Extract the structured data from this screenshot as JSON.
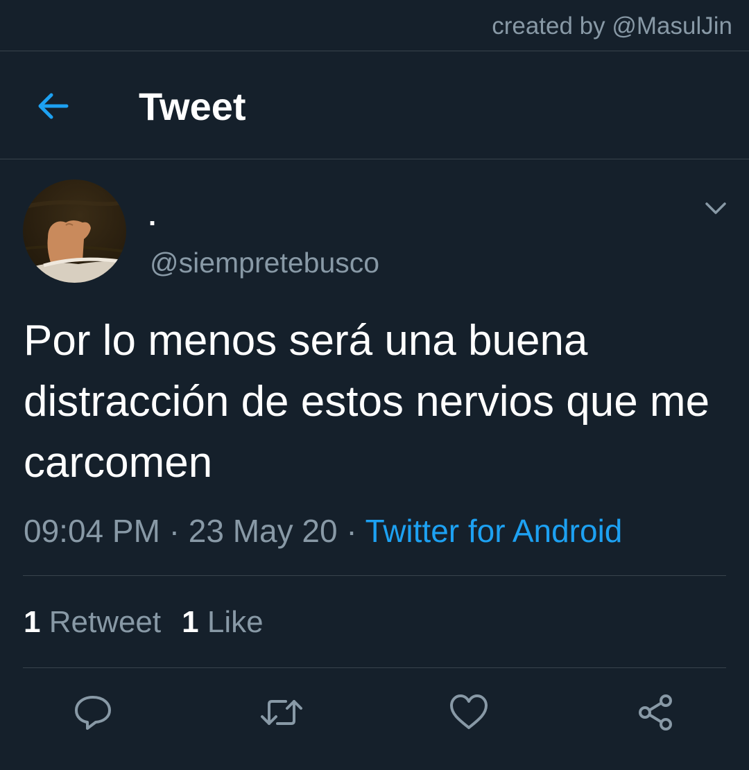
{
  "credit": "created by @MasulJin",
  "header": {
    "title": "Tweet",
    "back_icon": "arrow-left-icon"
  },
  "tweet": {
    "display_name": ".",
    "handle": "@siempretebusco",
    "text": "Por lo menos será una buena distracción de estos nervios que me carcomen",
    "time": "09:04 PM",
    "separator": "·",
    "date": "23 May 20",
    "source": "Twitter for Android",
    "retweet_count": "1",
    "retweet_label": "Retweet",
    "like_count": "1",
    "like_label": "Like",
    "more_icon": "chevron-down-icon",
    "actions": [
      "reply-icon",
      "retweet-icon",
      "heart-icon",
      "share-icon"
    ]
  },
  "colors": {
    "background": "#15202b",
    "divider": "#38444d",
    "secondary_text": "#8899a6",
    "accent": "#1da1f2",
    "primary_text": "#ffffff"
  }
}
